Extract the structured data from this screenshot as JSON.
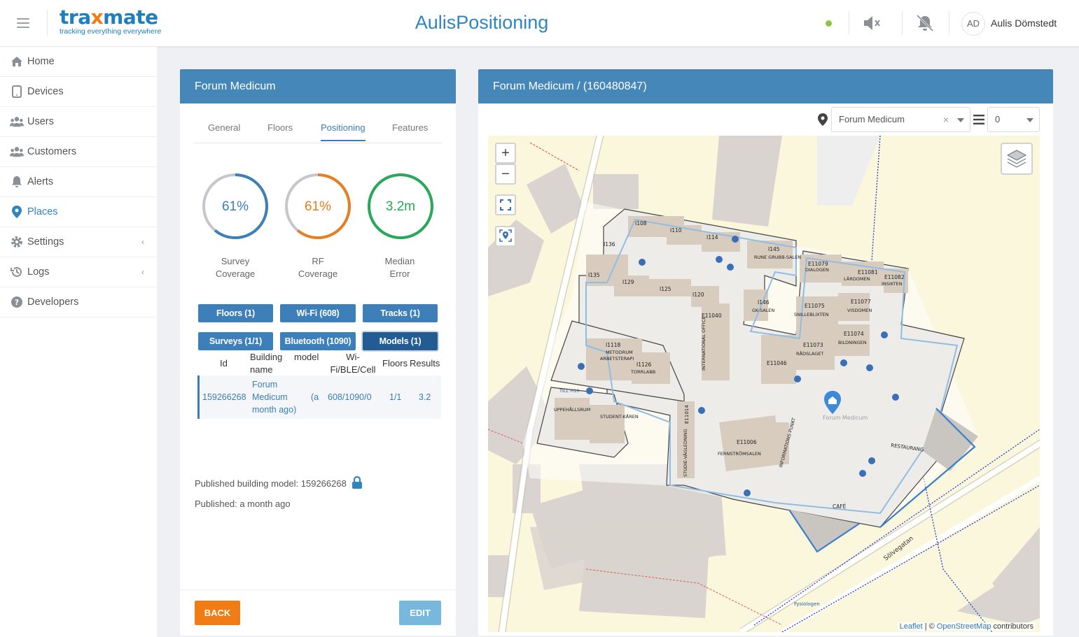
{
  "header": {
    "logo_main_a": "tra",
    "logo_main_x": "x",
    "logo_main_b": "mate",
    "logo_sub": "tracking everything everywhere",
    "title": "AulisPositioning",
    "status_color": "#8dc63f",
    "user_initials": "AD",
    "user_name": "Aulis Dömstedt"
  },
  "sidebar": {
    "items": [
      {
        "label": "Home",
        "icon": "home-icon"
      },
      {
        "label": "Devices",
        "icon": "tablet-icon"
      },
      {
        "label": "Users",
        "icon": "users-icon"
      },
      {
        "label": "Customers",
        "icon": "customers-icon"
      },
      {
        "label": "Alerts",
        "icon": "bell-icon"
      },
      {
        "label": "Places",
        "icon": "map-pin-icon",
        "active": true
      },
      {
        "label": "Settings",
        "icon": "gear-icon",
        "chevron": "‹"
      },
      {
        "label": "Logs",
        "icon": "history-icon",
        "chevron": "‹"
      },
      {
        "label": "Developers",
        "icon": "help-icon"
      }
    ]
  },
  "left_panel": {
    "title": "Forum Medicum",
    "tabs": [
      "General",
      "Floors",
      "Positioning",
      "Features"
    ],
    "active_tab": "Positioning",
    "gauges": [
      {
        "value_text": "61%",
        "label_1": "Survey",
        "label_2": "Coverage",
        "fraction": 0.61,
        "color": "#3d7fb8"
      },
      {
        "value_text": "61%",
        "label_1": "RF",
        "label_2": "Coverage",
        "fraction": 0.61,
        "color": "#e67e22"
      },
      {
        "value_text": "3.2m",
        "label_1": "Median",
        "label_2": "Error",
        "fraction": 1.0,
        "color": "#27a85a"
      }
    ],
    "buttons_row1": [
      "Floors (1)",
      "Wi-Fi (608)",
      "Tracks (1)"
    ],
    "buttons_row2": [
      "Surveys (1/1)",
      "Bluetooth (1090)",
      "Models (1)"
    ],
    "table": {
      "headers": {
        "id": "Id",
        "building_1": "Building",
        "building_2": "name",
        "model": "model",
        "wifi_1": "Wi-",
        "wifi_2": "Fi/BLE/Cell",
        "floors": "Floors",
        "results": "Results"
      },
      "row": {
        "id": "159266268",
        "name_1": "Forum",
        "name_2": "Medicum",
        "name_3": "month ago)",
        "model": "(a",
        "wifi": "608/1090/0",
        "floors": "1/1",
        "results": "3.2"
      }
    },
    "published_model": "Published building model: 159266268",
    "published_time": "Published: a month ago",
    "back_label": "BACK",
    "edit_label": "EDIT"
  },
  "right_panel": {
    "title": "Forum Medicum /  (160480847)",
    "place_select": "Forum Medicum",
    "clear_symbol": "×",
    "floor_select": "0",
    "zoom_in": "+",
    "zoom_out": "−",
    "map_labels": {
      "leaflet": "Leaflet",
      "osm": "OpenStreetMap",
      "contributors": "contributors",
      "separator": "| ©",
      "street": "Sölvegatan",
      "building_label": "Forum Medicum",
      "rooms": [
        "I108",
        "I110",
        "I114",
        "I136",
        "I145",
        "RUNE GRUBB-SALEN",
        "I135",
        "I129",
        "I125",
        "I120",
        "I146",
        "GK-SALEN",
        "E11079",
        "DIALOGEN",
        "E11081",
        "LÄRDOMEN",
        "E11082",
        "INSIKTEN",
        "E11075",
        "SNILLEBLIXTEN",
        "E11077",
        "VISDOMEN",
        "E11040",
        "E11074",
        "BILDNINGEN",
        "E11073",
        "RÅDSLAGET",
        "E11046",
        "I1118",
        "METODRUM",
        "ARBETSTERAPI",
        "I1126",
        "TORRLABB",
        "INTERNATIONAL OFFICE",
        "TILL H10",
        "UPPEHÅLLSRUM",
        "STUDENT-KÅREN",
        "E11014",
        "E11006",
        "FERNSTRÖMSALEN",
        "STUDIE-VÄGLEDNING",
        "INFORMATIONS-PUNKT",
        "RESTAURANG",
        "CAFÉ",
        "Fysiologen"
      ]
    }
  }
}
